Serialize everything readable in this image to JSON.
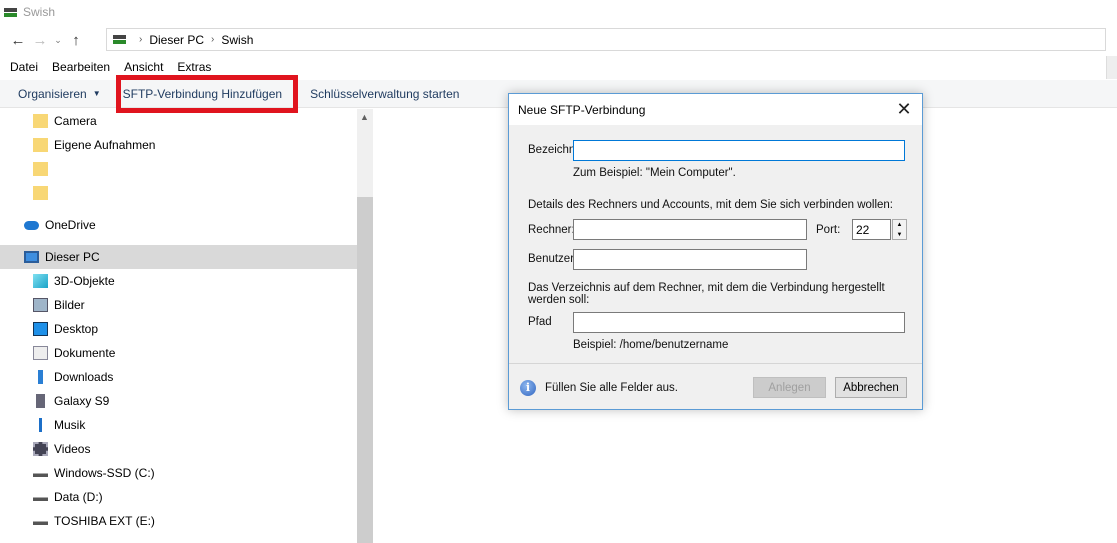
{
  "window": {
    "title": "Swish"
  },
  "address": {
    "crumbs": [
      "Dieser PC",
      "Swish"
    ]
  },
  "menu": [
    "Datei",
    "Bearbeiten",
    "Ansicht",
    "Extras"
  ],
  "toolbar": {
    "organize": "Organisieren",
    "add_sftp": "SFTP-Verbindung Hinzufügen",
    "key_manager": "Schlüsselverwaltung starten"
  },
  "sidebar": {
    "items": [
      {
        "label": "Camera",
        "icon": "folder-icon"
      },
      {
        "label": "Eigene Aufnahmen",
        "icon": "folder-icon"
      },
      {
        "label": "",
        "icon": "folder-icon"
      },
      {
        "label": "",
        "icon": "folder-icon"
      },
      {
        "label": "OneDrive",
        "icon": "cloud-icon"
      },
      {
        "label": "Dieser PC",
        "icon": "computer-icon",
        "selected": true
      },
      {
        "label": "3D-Objekte",
        "icon": "cube-icon"
      },
      {
        "label": "Bilder",
        "icon": "pictures-icon"
      },
      {
        "label": "Desktop",
        "icon": "desktop-icon"
      },
      {
        "label": "Dokumente",
        "icon": "document-icon"
      },
      {
        "label": "Downloads",
        "icon": "download-icon"
      },
      {
        "label": "Galaxy S9",
        "icon": "phone-icon"
      },
      {
        "label": "Musik",
        "icon": "music-icon"
      },
      {
        "label": "Videos",
        "icon": "video-icon"
      },
      {
        "label": "Windows-SSD (C:)",
        "icon": "drive-icon"
      },
      {
        "label": "Data (D:)",
        "icon": "drive-icon"
      },
      {
        "label": "TOSHIBA EXT (E:)",
        "icon": "drive-icon"
      }
    ]
  },
  "dialog": {
    "title": "Neue SFTP-Verbindung",
    "name_label": "Bezeichn",
    "name_value": "",
    "name_hint": "Zum Beispiel: \"Mein Computer\".",
    "details_text": "Details des Rechners und Accounts, mit dem Sie sich verbinden wollen:",
    "host_label": "Rechner:",
    "host_value": "",
    "port_label": "Port:",
    "port_value": "22",
    "user_label": "Benutzer:",
    "user_value": "",
    "dir_text": "Das Verzeichnis auf dem Rechner, mit dem die Verbindung hergestellt werden soll:",
    "path_label": "Pfad",
    "path_value": "",
    "path_hint": "Beispiel: /home/benutzername",
    "status": "Füllen Sie alle Felder aus.",
    "create": "Anlegen",
    "cancel": "Abbrechen"
  },
  "colors": {
    "highlight": "#e0141e",
    "dialog_border": "#5b9bd5",
    "selected": "#d9d9d9"
  }
}
